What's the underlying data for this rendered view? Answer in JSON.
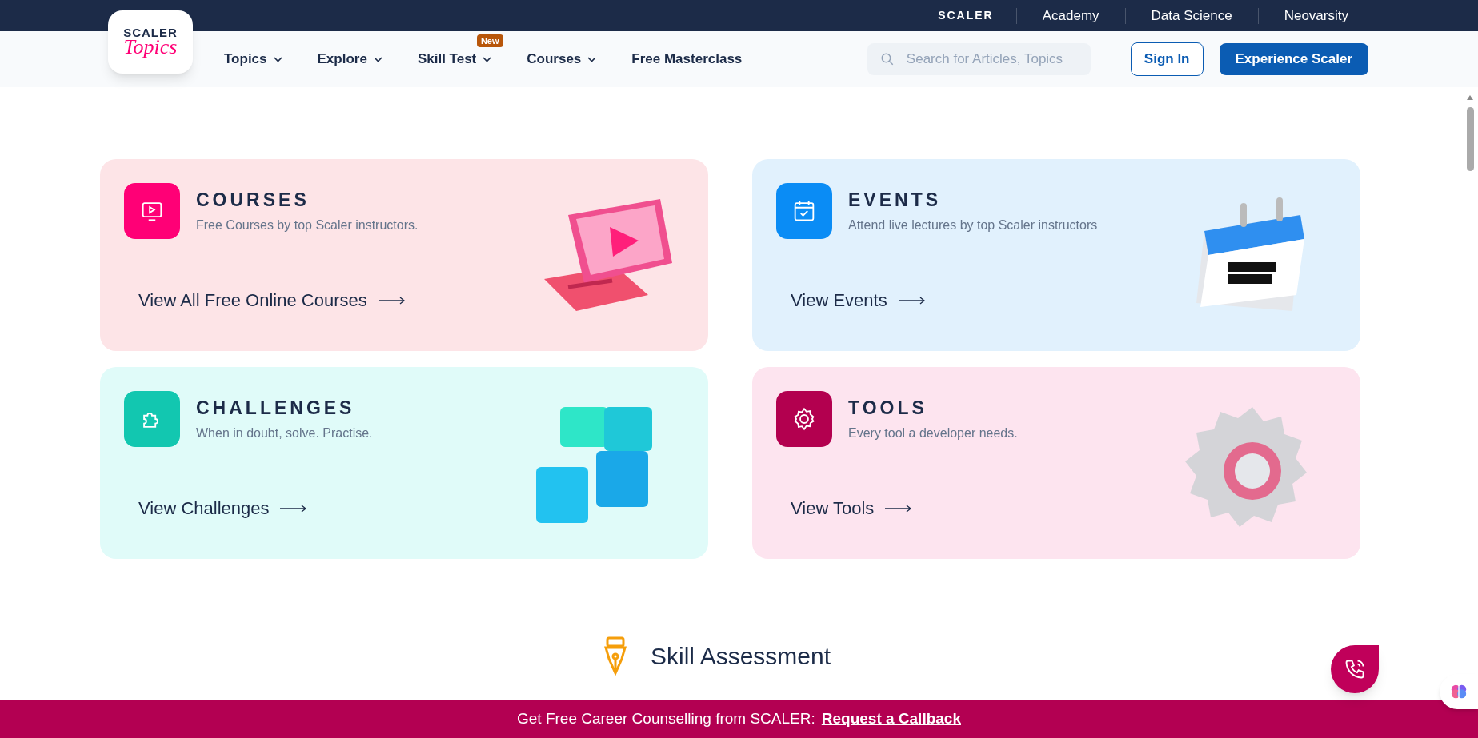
{
  "top_bar": {
    "brand": "SCALER",
    "links": [
      "Academy",
      "Data Science",
      "Neovarsity"
    ]
  },
  "logo": {
    "line1": "SCALER",
    "line2": "Topics"
  },
  "nav": [
    {
      "label": "Topics",
      "dropdown": true
    },
    {
      "label": "Explore",
      "dropdown": true
    },
    {
      "label": "Skill Test",
      "dropdown": true,
      "badge": "New"
    },
    {
      "label": "Courses",
      "dropdown": true
    },
    {
      "label": "Free Masterclass",
      "dropdown": false
    }
  ],
  "search": {
    "placeholder": "Search for Articles, Topics"
  },
  "buttons": {
    "sign_in": "Sign In",
    "cta": "Experience Scaler"
  },
  "cards": [
    {
      "kind": "courses",
      "color": "#ff0076",
      "title": "COURSES",
      "subtitle": "Free Courses by top Scaler instructors.",
      "link": "View All Free Online Courses"
    },
    {
      "kind": "events",
      "color": "#0a8cf5",
      "title": "EVENTS",
      "subtitle": "Attend live lectures by top Scaler instructors",
      "link": "View Events"
    },
    {
      "kind": "challenges",
      "color": "#12c7b0",
      "title": "CHALLENGES",
      "subtitle": "When in doubt, solve. Practise.",
      "link": "View Challenges"
    },
    {
      "kind": "tools",
      "color": "#b3004f",
      "title": "TOOLS",
      "subtitle": "Every tool a developer needs.",
      "link": "View Tools"
    }
  ],
  "section": {
    "title": "Skill Assessment"
  },
  "banner": {
    "text": "Get Free Career Counselling from SCALER:",
    "link": "Request a Callback"
  }
}
